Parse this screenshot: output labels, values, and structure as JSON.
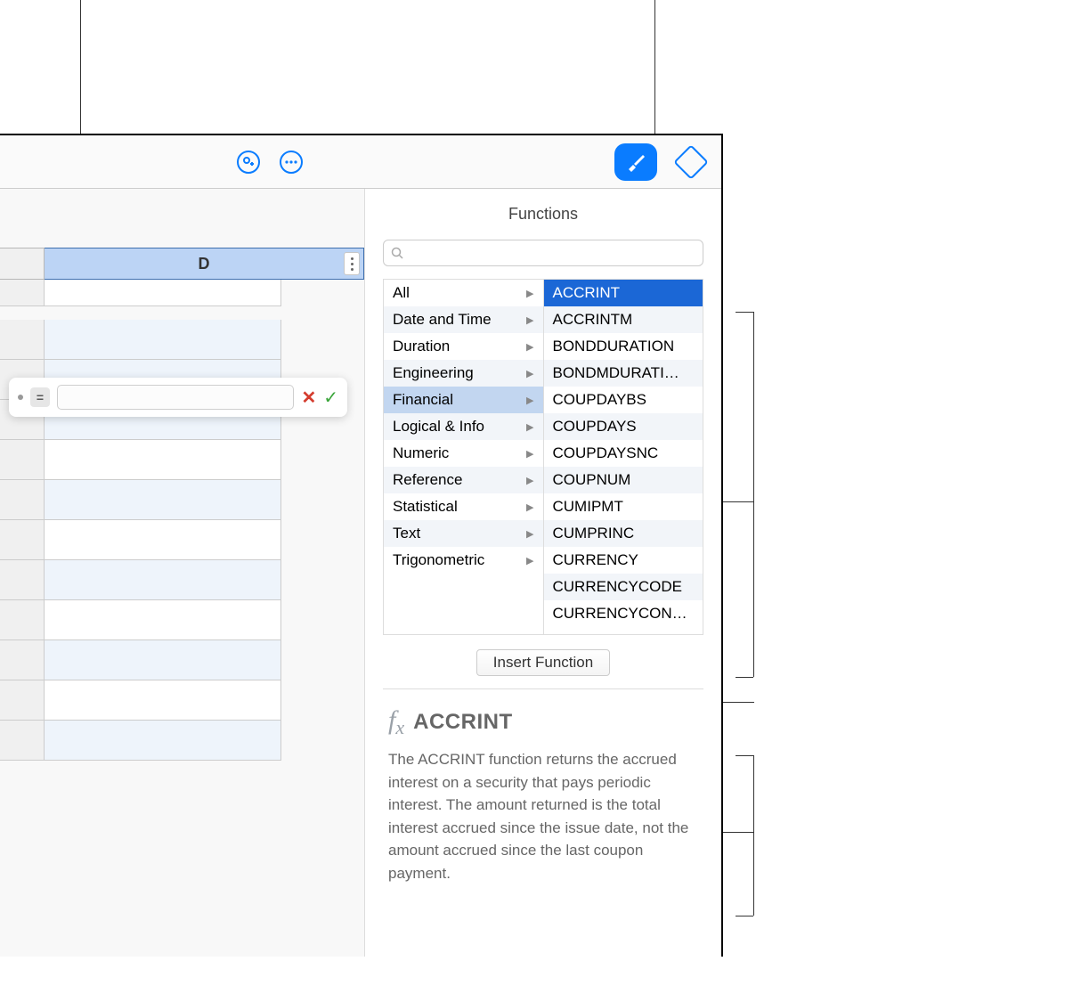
{
  "toolbar": {
    "collaborate_icon": "collaborate",
    "more_icon": "more",
    "format_icon": "paintbrush",
    "insert_icon": "shape"
  },
  "panel": {
    "title": "Functions",
    "search_placeholder": "",
    "categories": [
      "All",
      "Date and Time",
      "Duration",
      "Engineering",
      "Financial",
      "Logical & Info",
      "Numeric",
      "Reference",
      "Statistical",
      "Text",
      "Trigonometric"
    ],
    "selected_category_index": 4,
    "functions": [
      "ACCRINT",
      "ACCRINTM",
      "BONDDURATION",
      "BONDMDURATI…",
      "COUPDAYBS",
      "COUPDAYS",
      "COUPDAYSNC",
      "COUPNUM",
      "CUMIPMT",
      "CUMPRINC",
      "CURRENCY",
      "CURRENCYCODE",
      "CURRENCYCON…"
    ],
    "selected_function_index": 0,
    "insert_button": "Insert Function",
    "desc_title": "ACCRINT",
    "desc_text": "The ACCRINT function returns the accrued interest on a security that pays periodic interest. The amount returned is the total interest accrued since the issue date, not the amount accrued since the last coupon payment."
  },
  "sheet": {
    "column_label": "D",
    "formula_prefix": "="
  }
}
